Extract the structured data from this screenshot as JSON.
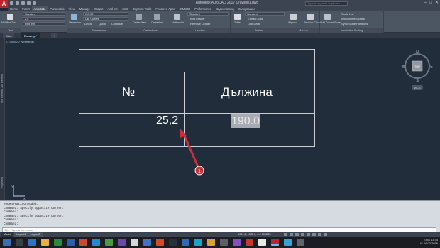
{
  "window": {
    "app_logo": "A",
    "title": "Autodesk AutoCAD 2017   Drawing1.dwg",
    "search_placeholder": "Type a keyword or phrase",
    "min": "–",
    "max": "□",
    "close": "✕"
  },
  "ribbon_tabs": [
    "Home",
    "Insert",
    "Annotate",
    "Parametric",
    "View",
    "Manage",
    "Output",
    "Add-ins",
    "A360",
    "Express Tools",
    "Featured Apps",
    "BIM 360",
    "Performance",
    "Видеопомощ",
    "Калкулации"
  ],
  "active_tab_index": 2,
  "ribbon": {
    "text_group": {
      "label": "Text",
      "big_button": "Multiline Text",
      "style": "Standard",
      "height": "2.5",
      "find": "Find text"
    },
    "dimensions_group": {
      "label": "Dimensions",
      "big_button": "Dimension",
      "style": "ISO-25",
      "layer": "Use Current",
      "linear": "Linear",
      "quick": "Quick",
      "continue": "Continue"
    },
    "centerlines_group": {
      "label": "Centerlines",
      "center_mark": "Center Mark",
      "centerline": "Centerline"
    },
    "leaders_group": {
      "label": "Leaders",
      "big_button": "Multileader",
      "style": "Standard",
      "add_leader": "Add Leader",
      "remove_leader": "Remove Leader"
    },
    "tables_group": {
      "label": "Tables",
      "big_button": "Table",
      "style": "Standard",
      "extract": "Extract Data",
      "link": "Link Data"
    },
    "markup_group": {
      "label": "Markup",
      "wipeout": "Wipeout",
      "revision_cloud": "Revision Cloud"
    },
    "annotation_scaling_group": {
      "label": "Annotation Scaling",
      "add_current_scale": "Add Current Scale",
      "scale_list": "Scale List",
      "add_delete": "Add/Delete Scales",
      "sync": "Sync Scale Positions"
    }
  },
  "file_tabs": [
    "Start",
    "Drawing1*"
  ],
  "active_file_tab_index": 1,
  "viewport_label": "[-][Top][2D Wireframe]",
  "palette_strip": [
    "Tool Palettes - All Palettes",
    "Properties"
  ],
  "table": {
    "header_left": "№",
    "header_right": "Дължина",
    "value_left": "25,2",
    "value_right": "190.0"
  },
  "annotation": {
    "marker_number": "1",
    "color": "#c8303c"
  },
  "compass": {
    "n": "N",
    "s": "S",
    "e": "E",
    "w": "W",
    "center": "TOP",
    "wcs": "WCS"
  },
  "command_history": [
    "Regenerating model.",
    "Command: Specify opposite corner:",
    "Command:",
    "Command: Specify opposite corner:",
    "Command:",
    "Command:"
  ],
  "command_input": {
    "placeholder": "Type a command",
    "prompt": "✕ ▷"
  },
  "layout_tabs": [
    "Model",
    "Layout1",
    "Layout2"
  ],
  "active_layout_index": 0,
  "coordinates": "1981.2, 1535.2, 0.0   MODEL",
  "tray": {
    "lang": "ENG",
    "region": "US",
    "time": "13:34",
    "date": "16.03.2016"
  },
  "colors": {
    "accent": "#c8202a",
    "drawing_bg": "#212d3b",
    "ribbon_bg": "#4c5663"
  }
}
